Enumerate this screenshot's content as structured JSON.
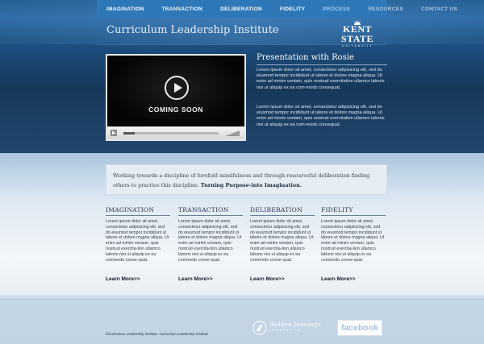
{
  "nav": {
    "items": [
      {
        "label": "IMAGINATION",
        "dim": false
      },
      {
        "label": "TRANSACTION",
        "dim": false
      },
      {
        "label": "DELIBERATION",
        "dim": false
      },
      {
        "label": "FIDELITY",
        "dim": false
      },
      {
        "label": "PROCESS",
        "dim": true
      },
      {
        "label": "RESOURCES",
        "dim": true
      },
      {
        "label": "CONTACT US",
        "dim": true
      }
    ]
  },
  "header": {
    "site_title": "Curriculum Leadership Institute",
    "logo": {
      "main": "KENT STATE",
      "sub": "UNIVERSITY"
    }
  },
  "video": {
    "overlay_text": "COMING SOON",
    "progress": 0.12
  },
  "presentation": {
    "title": "Presentation with Rosie",
    "paragraphs": [
      "Lorem ipsum dolor sit amet, consectetur adipisicing elit, sed do eiusmod tempor incididunt ut labore et dolore magna aliqua. Ut enim ad minim veniam, quis nostrud exercitation ullamco laboris nisi ut aliquip ex ea com-modo consequat.",
      "Lorem ipsum dolor sit amet, consectetur adipisicing elit, sed do eiusmod tempor incididunt ut labore et dolore magna aliqua. Ut enim ad minim veniam, quis nostrud exercitation ullamco laboris nisi ut aliquip ex ea com-modo consequat."
    ]
  },
  "quote": {
    "text": "Working towards a discipline of forefold mindfulness and through resourceful deliberation finding others to practice this discipline.",
    "emphasis": "Turning Purpose-into Imagination."
  },
  "columns": [
    {
      "title": "IMAGINATION",
      "body": "Lorem ipsum dolor sit amet, consectetur adipisicing elit, sed do eiusmod tempor incididunt ut labore et dolore magna aliqua. Ut enim ad minim veniam, quis nostrud exercita-tion ullamco laboris nisi ut aliquip ex ea commodo conse-quat.",
      "link": "Learn More>>"
    },
    {
      "title": "TRANSACTION",
      "body": "Lorem ipsum dolor sit amet, consectetur adipisicing elit, sed do eiusmod tempor incididunt ut labore et dolore magna aliqua. Ut enim ad minim veniam, quis nostrud exercita-tion ullamco laboris nisi ut aliquip ex ea commodo conse-quat.",
      "link": "Learn More>>"
    },
    {
      "title": "DELIBERATION",
      "body": "Lorem ipsum dolor sit amet, consectetur adipisicing elit, sed do eiusmod tempor incididunt ut labore et dolore magna aliqua. Ut enim ad minim veniam, quis nostrud exercita-tion ullamco laboris nisi ut aliquip ex ea commodo conse-quat.",
      "link": "Learn More>>"
    },
    {
      "title": "FIDELITY",
      "body": "Lorem ipsum dolor sit amet, consectetur adipisicing elit, sed do eiusmod tempor incididunt ut labore et dolore magna aliqua. Ut enim ad minim veniam, quis nostrud exercita-tion ullamco laboris nisi ut aliquip ex ea commodo conse-quat.",
      "link": "Learn More>>"
    }
  ],
  "footer": {
    "copyright": "©Curriculum Leadership Institute. Curriculum Leadership Institute",
    "partner_name": "Holden Jennings",
    "partner_tagline": "INNOVATIVE",
    "facebook_label": "facebook"
  },
  "colors": {
    "nav_bar": "#2e78b8",
    "hero_dark": "#16385a",
    "lower_light": "#f3f6f9"
  },
  "icons": [
    "play-icon",
    "kent-state-sun-icon",
    "volume-icon",
    "holden-jennings-logo-icon"
  ]
}
